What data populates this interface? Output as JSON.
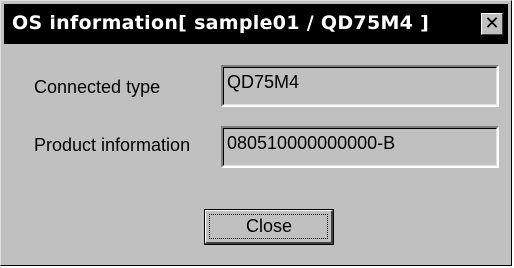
{
  "window": {
    "title": "OS information[ sample01 / QD75M4 ]",
    "close_glyph": "✕"
  },
  "fields": {
    "connected_type": {
      "label": "Connected type",
      "value": "QD75M4"
    },
    "product_information": {
      "label": "Product information",
      "value": "080510000000000-B"
    }
  },
  "buttons": {
    "close_label": "Close"
  },
  "colors": {
    "titlebar_bg": "#000000",
    "titlebar_text": "#ffffff",
    "dialog_bg": "#c0c0c0"
  },
  "icons": {
    "close": "close-icon"
  }
}
